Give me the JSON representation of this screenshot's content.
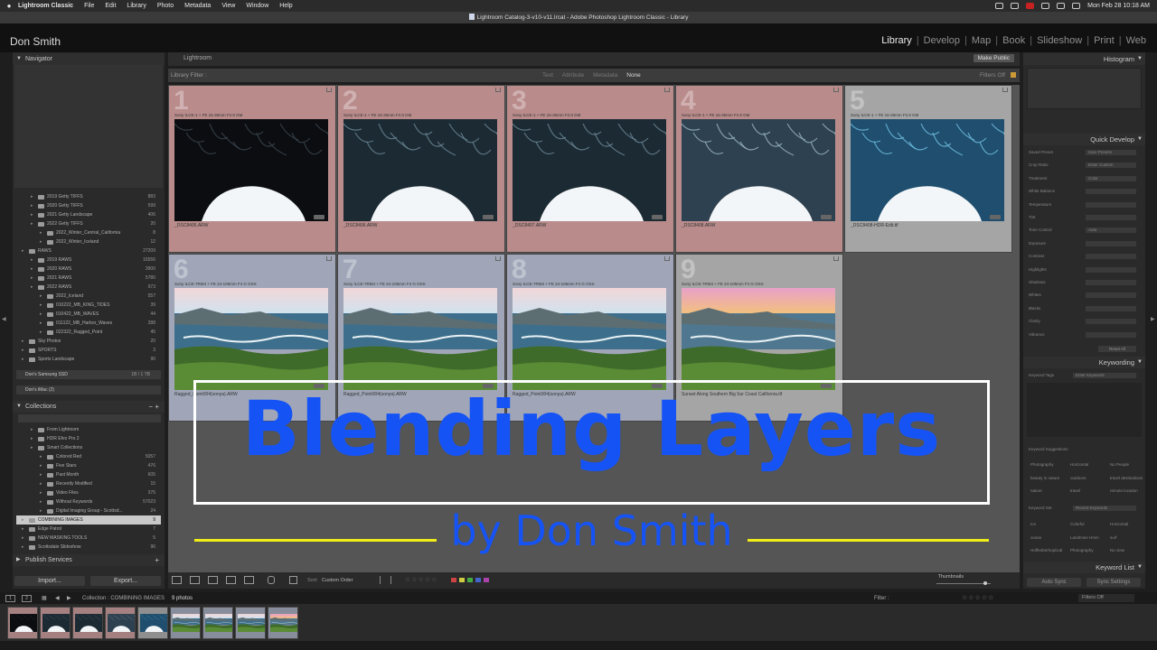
{
  "menubar": {
    "app": "Lightroom Classic",
    "items": [
      "File",
      "Edit",
      "Library",
      "Photo",
      "Metadata",
      "View",
      "Window",
      "Help"
    ],
    "datetime": "Mon Feb 28  10:18 AM"
  },
  "window_title": "Lightroom Catalog-3-v10-v11.lrcat - Adobe Photoshop Lightroom Classic - Library",
  "identity_plate": "Don Smith",
  "modules": [
    "Library",
    "Develop",
    "Map",
    "Book",
    "Slideshow",
    "Print",
    "Web"
  ],
  "active_module": "Library",
  "left_panel": {
    "navigator_label": "Navigator",
    "folders": [
      {
        "label": "2019 Getty TIFFS",
        "count": "883",
        "indent": 1
      },
      {
        "label": "2020 Getty TIFFS",
        "count": "599",
        "indent": 1
      },
      {
        "label": "2021 Getty Landscape",
        "count": "406",
        "indent": 1
      },
      {
        "label": "2022 Getty TIFFS",
        "count": "20",
        "indent": 1
      },
      {
        "label": "2022_Winter_Central_California",
        "count": "8",
        "indent": 2
      },
      {
        "label": "2022_Winter_Iceland",
        "count": "12",
        "indent": 2
      },
      {
        "label": "RAWS",
        "count": "27209",
        "indent": 0
      },
      {
        "label": "2019 RAWS",
        "count": "16556",
        "indent": 1
      },
      {
        "label": "2020 RAWS",
        "count": "3900",
        "indent": 1
      },
      {
        "label": "2021 RAWS",
        "count": "5780",
        "indent": 1
      },
      {
        "label": "2022 RAWS",
        "count": "973",
        "indent": 1
      },
      {
        "label": "2022_Iceland",
        "count": "557",
        "indent": 2
      },
      {
        "label": "010222_MB_KING_TIDES",
        "count": "39",
        "indent": 2
      },
      {
        "label": "010422_MB_WAVES",
        "count": "44",
        "indent": 2
      },
      {
        "label": "011122_MB_Harbor_Waves",
        "count": "288",
        "indent": 2
      },
      {
        "label": "022322_Ragged_Point",
        "count": "45",
        "indent": 2
      },
      {
        "label": "Sky Photos",
        "count": "20",
        "indent": 0
      },
      {
        "label": "SPORTS",
        "count": "3",
        "indent": 0
      },
      {
        "label": "Sports Landscape",
        "count": "90",
        "indent": 0
      }
    ],
    "volumes": [
      {
        "label": "Don's Samsung SSD",
        "meter": "1B / 1 TB"
      },
      {
        "label": "Don's iMac (2)",
        "meter": ""
      }
    ],
    "collections_label": "Collections",
    "collections": [
      {
        "label": "From Lightroom",
        "count": "",
        "indent": 1
      },
      {
        "label": "HDR Efex Pro 2",
        "count": "",
        "indent": 1
      },
      {
        "label": "Smart Collections",
        "count": "",
        "indent": 1
      },
      {
        "label": "Colored Red",
        "count": "5057",
        "indent": 2
      },
      {
        "label": "Five Stars",
        "count": "476",
        "indent": 2
      },
      {
        "label": "Past Month",
        "count": "605",
        "indent": 2
      },
      {
        "label": "Recently Modified",
        "count": "15",
        "indent": 2
      },
      {
        "label": "Video Files",
        "count": "375",
        "indent": 2
      },
      {
        "label": "Without Keywords",
        "count": "57023",
        "indent": 2
      },
      {
        "label": "Digital Imaging Group - Scottsd...",
        "count": "24",
        "indent": 2
      },
      {
        "label": "COMBINING IMAGES",
        "count": "9",
        "indent": 0,
        "selected": true
      },
      {
        "label": "Edge Patrol",
        "count": "7",
        "indent": 0
      },
      {
        "label": "NEW MASKING TOOLS",
        "count": "5",
        "indent": 0
      },
      {
        "label": "Scottsdale Slideshow",
        "count": "96",
        "indent": 0
      }
    ],
    "publish_label": "Publish Services",
    "import_label": "Import...",
    "export_label": "Export..."
  },
  "center": {
    "top_label": "Lightroom",
    "make_public": "Make Public",
    "filter_label": "Library Filter :",
    "filter_options": [
      "Text",
      "Attribute",
      "Metadata",
      "None"
    ],
    "filter_active": "None",
    "filters_off": "Filters Off",
    "cells": [
      {
        "num": "1",
        "camera": "Sony ILCE-1 + FE 16-35mm F2.8 GM",
        "file": "_DSC8405.ARW",
        "color": "pink",
        "kind": "cave",
        "tone": "dark"
      },
      {
        "num": "2",
        "camera": "Sony ILCE-1 + FE 16-35mm F2.8 GM",
        "file": "_DSC8406.ARW",
        "color": "pink",
        "kind": "cave",
        "tone": "mid"
      },
      {
        "num": "3",
        "camera": "Sony ILCE-1 + FE 16-35mm F2.8 GM",
        "file": "_DSC8407.ARW",
        "color": "pink",
        "kind": "cave",
        "tone": "mid"
      },
      {
        "num": "4",
        "camera": "Sony ILCE-1 + FE 16-35mm F2.8 GM",
        "file": "_DSC8408.ARW",
        "color": "pink",
        "kind": "cave",
        "tone": "bright"
      },
      {
        "num": "5",
        "camera": "Sony ILCE-1 + FE 16-35mm F2.8 GM",
        "file": "_DSC8408-HDR-Edit.tif",
        "color": "grey",
        "kind": "cave",
        "tone": "blue"
      },
      {
        "num": "6",
        "camera": "Sony ILCE-7RM4 + FE 24-105mm F4 G OSS",
        "file": "Ragged_Point004(sonya).ARW",
        "color": "blue",
        "kind": "coast",
        "tone": "day"
      },
      {
        "num": "7",
        "camera": "Sony ILCE-7RM4 + FE 24-105mm F4 G OSS",
        "file": "Ragged_Point004(sonya).ARW",
        "color": "blue",
        "kind": "coast",
        "tone": "day"
      },
      {
        "num": "8",
        "camera": "Sony ILCE-7RM4 + FE 24-105mm F4 G OSS",
        "file": "Ragged_Point004(sonya).ARW",
        "color": "blue",
        "kind": "coast",
        "tone": "day"
      },
      {
        "num": "9",
        "camera": "Sony ILCE-7RM4 + FE 24-105mm F4 G OSS",
        "file": "Sunset Along Southern Big Sur Coast California.tif",
        "color": "grey",
        "kind": "coast",
        "tone": "sunset"
      }
    ]
  },
  "overlay": {
    "title": "Blending Layers",
    "byline": "by Don Smith",
    "title_color": "#1553f5",
    "line_color": "#f0ee17"
  },
  "toolbar": {
    "sort_label": "Sort:",
    "sort_value": "Custom Order",
    "thumbnails_label": "Thumbnails",
    "stars": "☆☆☆☆☆",
    "label_colors": [
      "#c44",
      "#cc4",
      "#4a4",
      "#46c",
      "#a4a"
    ]
  },
  "right_panel": {
    "histogram_label": "Histogram",
    "quick_develop_label": "Quick Develop",
    "qd_rows": [
      "Saved Preset",
      "Crop Ratio",
      "Treatment",
      "White Balance",
      "Temperature",
      "Tint",
      "Tone Control",
      "Exposure",
      "Contrast",
      "Highlights",
      "Shadows",
      "Whites",
      "Blacks",
      "Clarity",
      "Vibrance"
    ],
    "qd_values": {
      "Saved Preset": "User Presets",
      "Crop Ratio": "Enter Custom",
      "Treatment": "Color",
      "Tone Control": "Auto"
    },
    "reset_all": "Reset All",
    "keywording_label": "Keywording",
    "keyword_tags_label": "Keyword Tags",
    "keyword_tags_value": "Enter Keywords",
    "keyword_suggestions_label": "Keyword Suggestions",
    "suggestions": [
      "Photography",
      "Horizontal",
      "No People",
      "beauty in nature",
      "outdoors",
      "travel destinations",
      "nature",
      "travel",
      "remote location"
    ],
    "keyword_set_label": "Keyword Set",
    "keyword_set_value": "Recent Keywords",
    "set_keywords": [
      "Ice",
      "Colorful",
      "Horizontal",
      "ocean",
      "Landmine Hmm",
      "surf",
      "Hoffenberhoptical",
      "Photography",
      "No view"
    ],
    "keyword_list_label": "Keyword List",
    "auto_sync": "Auto Sync",
    "sync_settings": "Sync Settings"
  },
  "filmstrip": {
    "source_label": "Collection : COMBINING IMAGES",
    "count_label": "9 photos",
    "filter_label": "Filter :",
    "filters_off": "Filters Off",
    "thumbs": [
      "cave",
      "cave",
      "cave",
      "cave",
      "cave",
      "coast",
      "coast",
      "coast",
      "coast"
    ]
  }
}
